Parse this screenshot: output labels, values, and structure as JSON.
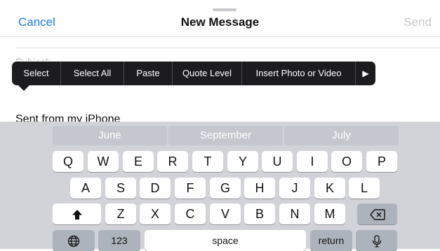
{
  "header": {
    "cancel_label": "Cancel",
    "title": "New Message",
    "send_label": "Send"
  },
  "form": {
    "subject_label": "Subject:",
    "signature": "Sent from my iPhone"
  },
  "edit_menu": {
    "items": [
      "Select",
      "Select All",
      "Paste",
      "Quote Level",
      "Insert Photo or Video"
    ],
    "more_icon": "play-triangle-icon"
  },
  "keyboard": {
    "suggestions": [
      "June",
      "September",
      "July"
    ],
    "row1": [
      "Q",
      "W",
      "E",
      "R",
      "T",
      "Y",
      "U",
      "I",
      "O",
      "P"
    ],
    "row2": [
      "A",
      "S",
      "D",
      "F",
      "G",
      "H",
      "J",
      "K",
      "L"
    ],
    "row3": [
      "Z",
      "X",
      "C",
      "V",
      "B",
      "N",
      "M"
    ],
    "shift_icon": "shift-arrow-icon",
    "delete_icon": "delete-backspace-icon",
    "globe_icon": "globe-icon",
    "numbers_label": "123",
    "space_label": "space",
    "return_label": "return",
    "mic_icon": "microphone-icon"
  },
  "colors": {
    "accent": "#1a7cf7",
    "disabled": "#c9c9ce",
    "menu_bg": "#1c1c1e",
    "keyboard_bg": "#d1d3d8"
  }
}
